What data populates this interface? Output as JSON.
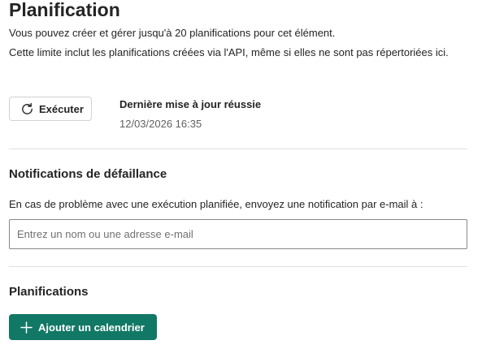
{
  "header": {
    "title": "Planification",
    "description_1": "Vous pouvez créer et gérer jusqu'à 20 planifications pour cet élément.",
    "description_2": "Cette limite inclut les planifications créées via l'API, même si elles ne sont pas répertoriées ici."
  },
  "run": {
    "button_label": "Exécuter",
    "icon": "refresh-icon",
    "status_title": "Dernière mise à jour réussie",
    "status_time": "12/03/2026 16:35"
  },
  "notifications": {
    "heading": "Notifications de défaillance",
    "description": "En cas de problème avec une exécution planifiée, envoyez une notification par e-mail à :",
    "input_value": "",
    "input_placeholder": "Entrez un nom ou une adresse e-mail"
  },
  "schedules": {
    "heading": "Planifications",
    "add_button_label": "Ajouter un calendrier",
    "add_icon": "plus-icon"
  },
  "colors": {
    "accent": "#117865",
    "text": "#242424",
    "secondary_text": "#616161",
    "divider": "#e0e0e0"
  }
}
